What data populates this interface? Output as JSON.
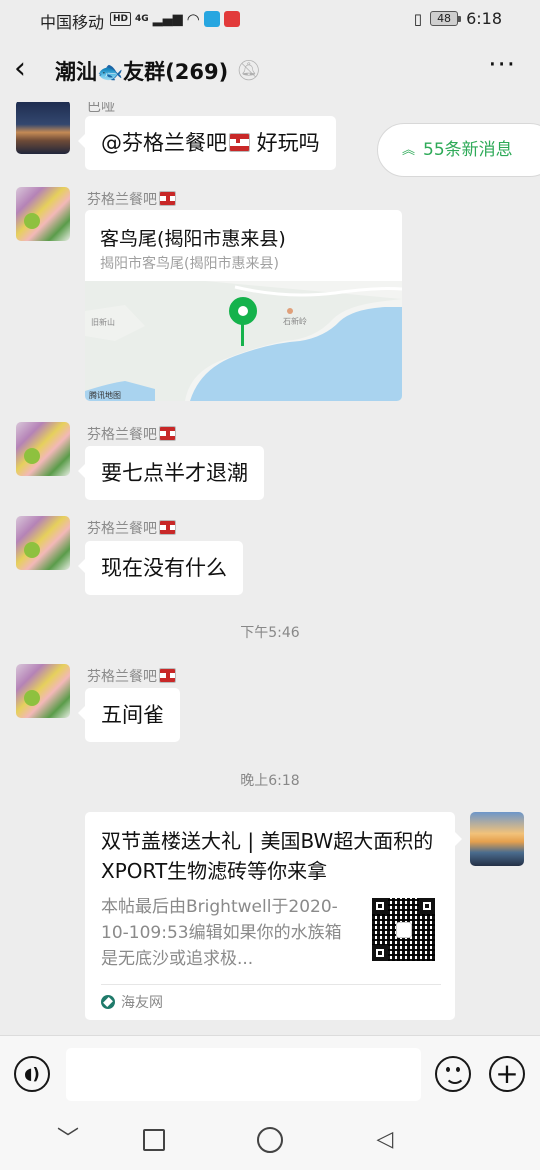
{
  "status_bar": {
    "carrier": "中国移动",
    "hd_badge": "HD",
    "network": "4G",
    "battery": "48",
    "time": "6:18"
  },
  "nav": {
    "back_icon": "chevron-left-icon",
    "title_prefix": "潮汕",
    "title_emoji": "🐟",
    "title_suffix": "友群(269)",
    "mute_icon": "bell-muted-icon",
    "more_label": "···"
  },
  "new_messages": {
    "label": "55条新消息",
    "icon": "double-chevron-up-icon"
  },
  "messages": [
    {
      "sender": "巴哑",
      "text": "@芬格兰餐吧",
      "text_after": " 好玩吗"
    },
    {
      "sender": "芬格兰餐吧",
      "location": {
        "title": "客鸟尾(揭阳市惠来县)",
        "address": "揭阳市客鸟尾(揭阳市惠来县)",
        "map_brand": "腾讯地图",
        "map_label_1": "旧新山",
        "map_label_2": "石新岭"
      }
    },
    {
      "sender": "芬格兰餐吧",
      "text": "要七点半才退潮"
    },
    {
      "sender": "芬格兰餐吧",
      "text": "现在没有什么"
    },
    {
      "sender": "芬格兰餐吧",
      "text": "五间雀"
    }
  ],
  "timestamps": [
    "下午5:46",
    "晚上6:18"
  ],
  "link_card": {
    "title": "双节盖楼送大礼 | 美国BW超大面积的XPORT生物滤砖等你来拿",
    "description": "本帖最后由Brightwell于2020-10-109:53编辑如果你的水族箱是无底沙或追求极...",
    "source": "海友网"
  },
  "input_bar": {
    "voice_icon": "voice-icon",
    "emoji_icon": "emoji-icon",
    "plus_label": "+"
  },
  "system_nav": {
    "down_label": "﹀",
    "back_label": "◁"
  }
}
